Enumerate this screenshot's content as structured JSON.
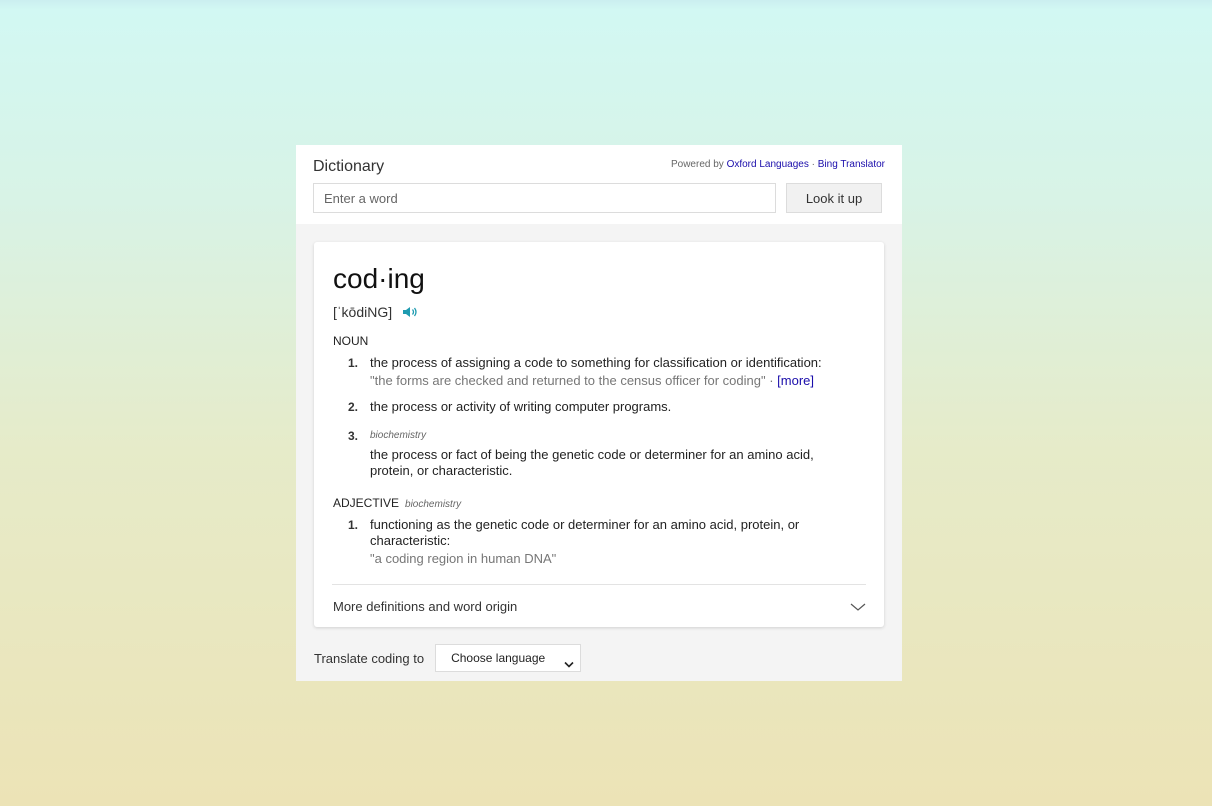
{
  "header": {
    "title": "Dictionary",
    "powered_prefix": "Powered by",
    "oxford_link": "Oxford Languages",
    "separator": " · ",
    "bing_link": "Bing Translator"
  },
  "search": {
    "placeholder": "Enter a word",
    "value": "",
    "button_label": "Look it up"
  },
  "entry": {
    "headword": "cod·ing",
    "pronunciation": "[ˈkōdiNG]",
    "speaker_icon": "speaker-icon",
    "noun": {
      "label": "NOUN",
      "senses": [
        {
          "num": "1.",
          "text": "the process of assigning a code to something for classification or identification:",
          "example": "\"the forms are checked and returned to the census officer for coding\"",
          "example_sep": " · ",
          "more": "[more]"
        },
        {
          "num": "2.",
          "text": "the process or activity of writing computer programs."
        },
        {
          "num": "3.",
          "domain": "biochemistry",
          "text": "the process or fact of being the genetic code or determiner for an amino acid, protein, or characteristic."
        }
      ]
    },
    "adjective": {
      "label": "ADJECTIVE",
      "domain": "biochemistry",
      "senses": [
        {
          "num": "1.",
          "text": "functioning as the genetic code or determiner for an amino acid, protein, or characteristic:",
          "example": "\"a coding region in human DNA\""
        }
      ]
    },
    "more_definitions": "More definitions and word origin"
  },
  "translate": {
    "label": "Translate coding to",
    "select_value": "Choose language"
  },
  "colors": {
    "link": "#1a0dab",
    "accent_speaker": "#1e9bb0",
    "panel_bg": "#f4f4f4"
  }
}
